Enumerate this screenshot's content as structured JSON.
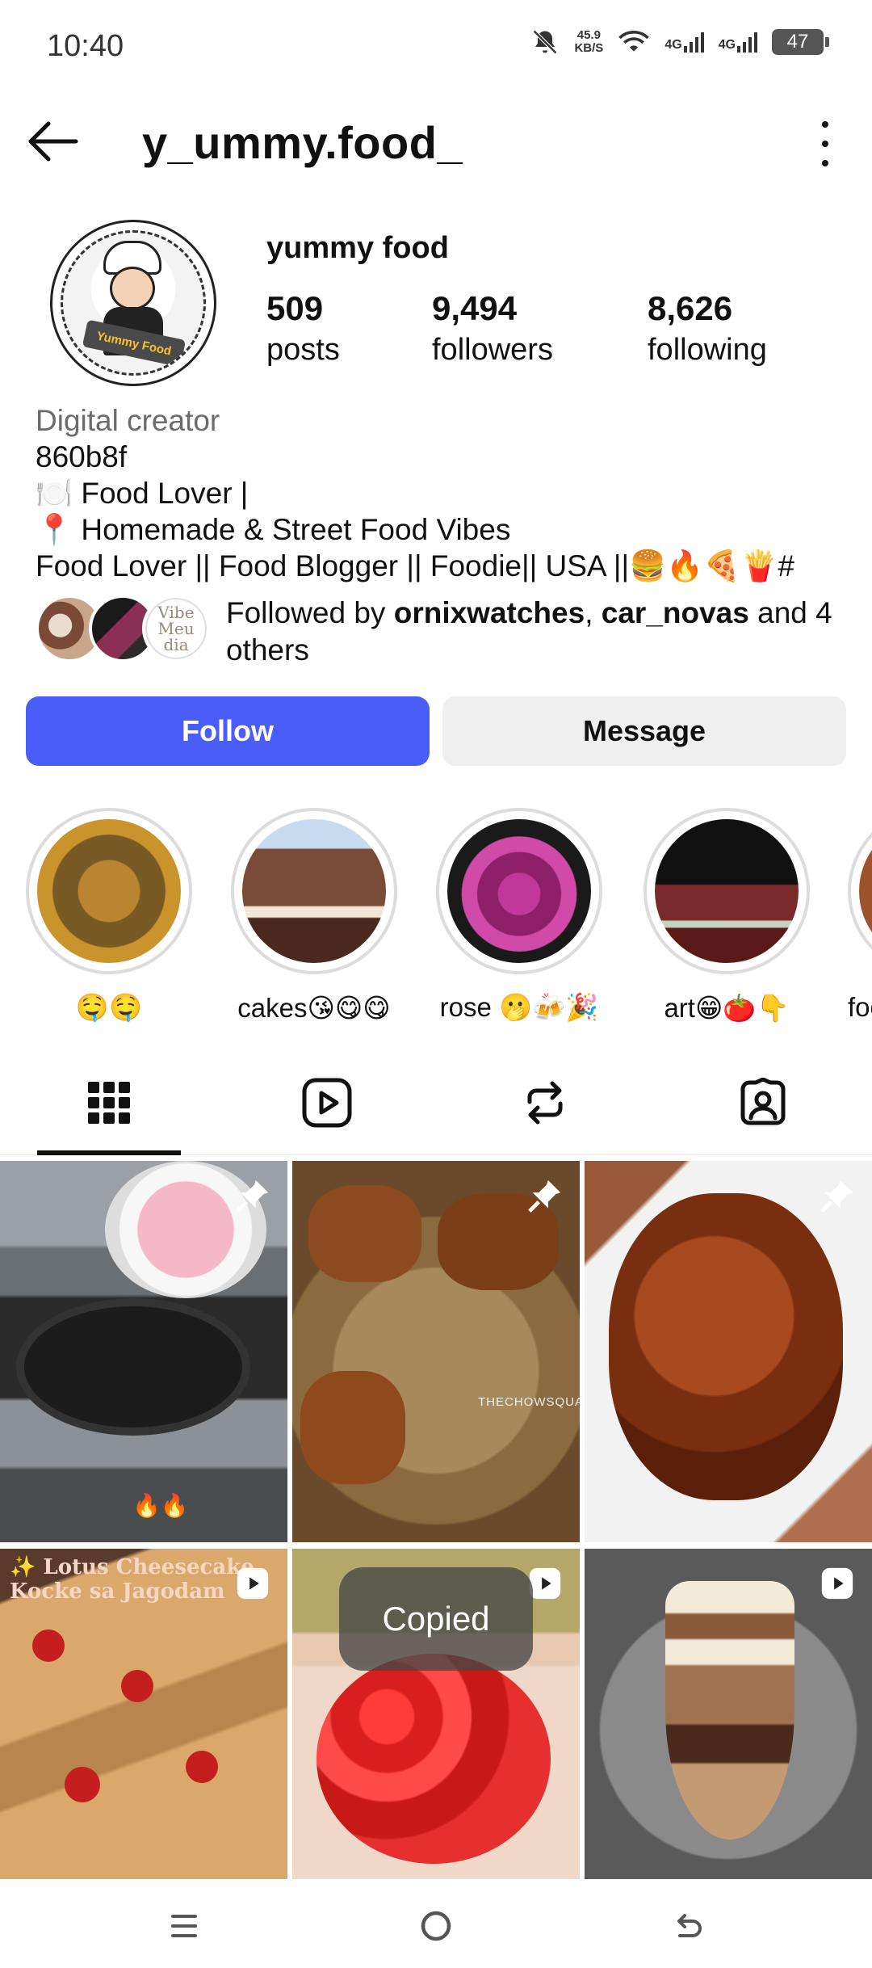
{
  "status_bar": {
    "time": "10:40",
    "net_speed_value": "45.9",
    "net_speed_unit": "KB/S",
    "signal1": "4G",
    "signal2": "4G",
    "battery": "47"
  },
  "header": {
    "username": "y_ummy.food_"
  },
  "profile": {
    "avatar_text": "Yummy Food",
    "display_name": "yummy food",
    "stats": [
      {
        "value": "509",
        "label": "posts"
      },
      {
        "value": "9,494",
        "label": "followers"
      },
      {
        "value": "8,626",
        "label": "following"
      }
    ],
    "bio": {
      "category": "Digital creator",
      "lines": [
        "860b8f",
        "🍽️ Food Lover |",
        "📍 Homemade & Street Food Vibes",
        "Food Lover || Food Blogger || Foodie|| USA ||🍔🔥🍕🍟#"
      ]
    },
    "followed_by": {
      "prefix": "Followed by ",
      "user1": "ornixwatches",
      "sep": ", ",
      "user2": "car_novas",
      "suffix": " and 4 others",
      "mini_avatar_text": "Vibe Meu dia"
    }
  },
  "actions": {
    "follow": "Follow",
    "message": "Message"
  },
  "highlights": [
    {
      "label": "🤤🤤",
      "color": "#c88a2e"
    },
    {
      "label": "cakes😘😋😋",
      "color": "#8a4a3a"
    },
    {
      "label": "rose 🫢🍻🎉",
      "color": "#8e1f6a"
    },
    {
      "label": "art😁🍅👇",
      "color": "#6b2a2a"
    },
    {
      "label": "foo",
      "color": "#a0522d"
    }
  ],
  "tabs": [
    {
      "name": "grid",
      "icon": "grid-icon"
    },
    {
      "name": "reels",
      "icon": "reels-icon"
    },
    {
      "name": "reposts",
      "icon": "repost-icon"
    },
    {
      "name": "tagged",
      "icon": "tagged-icon"
    }
  ],
  "grid": {
    "post1_caption": "🔥🔥",
    "post3_watermark": "THECHOWSQUA",
    "post4_caption_line1": "✨ Lotus Cheesecake",
    "post4_caption_line2": "Kocke sa Jagodam"
  },
  "toast": "Copied"
}
